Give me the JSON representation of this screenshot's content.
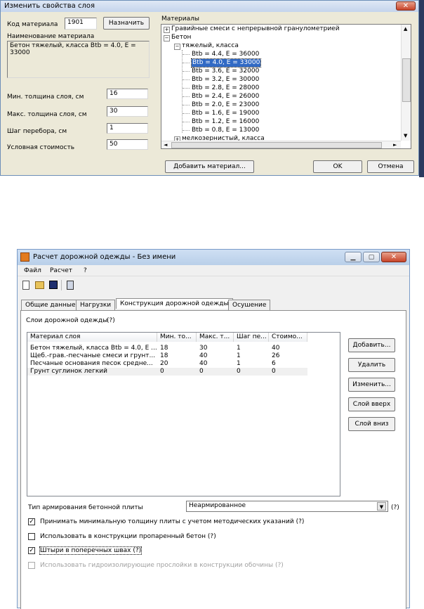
{
  "dialog": {
    "title": "Изменить свойства слоя",
    "code_label": "Код материала",
    "code_value": "1901",
    "assign_button": "Назначить",
    "material_name_label": "Наименование материала",
    "material_name_line1": "Бетон тяжелый, класса Btb = 4.0, E =",
    "material_name_line2": "33000",
    "min_thickness_label": "Мин. толщина слоя, см",
    "min_thickness_value": "16",
    "max_thickness_label": "Макс. толщина слоя, см",
    "max_thickness_value": "30",
    "step_label": "Шаг перебора, см",
    "step_value": "1",
    "cost_label": "Условная стоимость",
    "cost_value": "50",
    "materials_label": "Материалы",
    "tree": {
      "gravel": "Гравийные смеси с непрерывной гранулометрией",
      "concrete": "Бетон",
      "heavy": "тяжелый, класса",
      "items": [
        "Btb = 4.4, E = 36000",
        "Btb = 4.0, E = 33000",
        "Btb = 3.6, E = 32000",
        "Btb = 3.2, E = 30000",
        "Btb = 2.8, E = 28000",
        "Btb = 2.4, E = 26000",
        "Btb = 2.0, E = 23000",
        "Btb = 1.6, E = 19000",
        "Btb = 1.2, E = 16000",
        "Btb = 0.8, E = 13000"
      ],
      "fine": "мелкозернистый, класса"
    },
    "add_material_button": "Добавить материал...",
    "ok_button": "OK",
    "cancel_button": "Отмена"
  },
  "main": {
    "title": "Расчет дорожной одежды - Без имени",
    "menu": [
      "Файл",
      "Расчет",
      "?"
    ],
    "tabs": [
      "Общие данные",
      "Нагрузки",
      "Конструкция дорожной одежды",
      "Осушение"
    ],
    "layers_label": "Слои дорожной одежды",
    "layers_help": "(?)",
    "columns": [
      "Материал слоя",
      "Мин. то...",
      "Макс. т...",
      "Шаг пе...",
      "Стоимо..."
    ],
    "rows": [
      [
        "Бетон тяжелый, класса Btb = 4.0, E ...",
        "18",
        "30",
        "1",
        "40"
      ],
      [
        "Щеб.-грав.-песчаные смеси и грунт...",
        "18",
        "40",
        "1",
        "26"
      ],
      [
        "Песчаные основания песок средне...",
        "20",
        "40",
        "1",
        "6"
      ],
      [
        "Грунт суглинок легкий",
        "0",
        "0",
        "0",
        "0"
      ]
    ],
    "buttons": [
      "Добавить...",
      "Удалить",
      "Изменить...",
      "Слой вверх",
      "Слой вниз"
    ],
    "reinforcement_label": "Тип армирования бетонной плиты",
    "reinforcement_value": "Неармированное",
    "reinforcement_help": "(?)",
    "checkboxes": [
      {
        "label": "Принимать минимальную толщину плиты с учетом методических указаний (?)",
        "checked": true
      },
      {
        "label": "Использовать в конструкции пропаренный бетон  (?)",
        "checked": false
      },
      {
        "label": "Штыри в поперечных швах (?)",
        "checked": true
      },
      {
        "label": "Использовать гидроизолирующие прослойки в конструкции обочины  (?)",
        "checked": false
      }
    ]
  }
}
